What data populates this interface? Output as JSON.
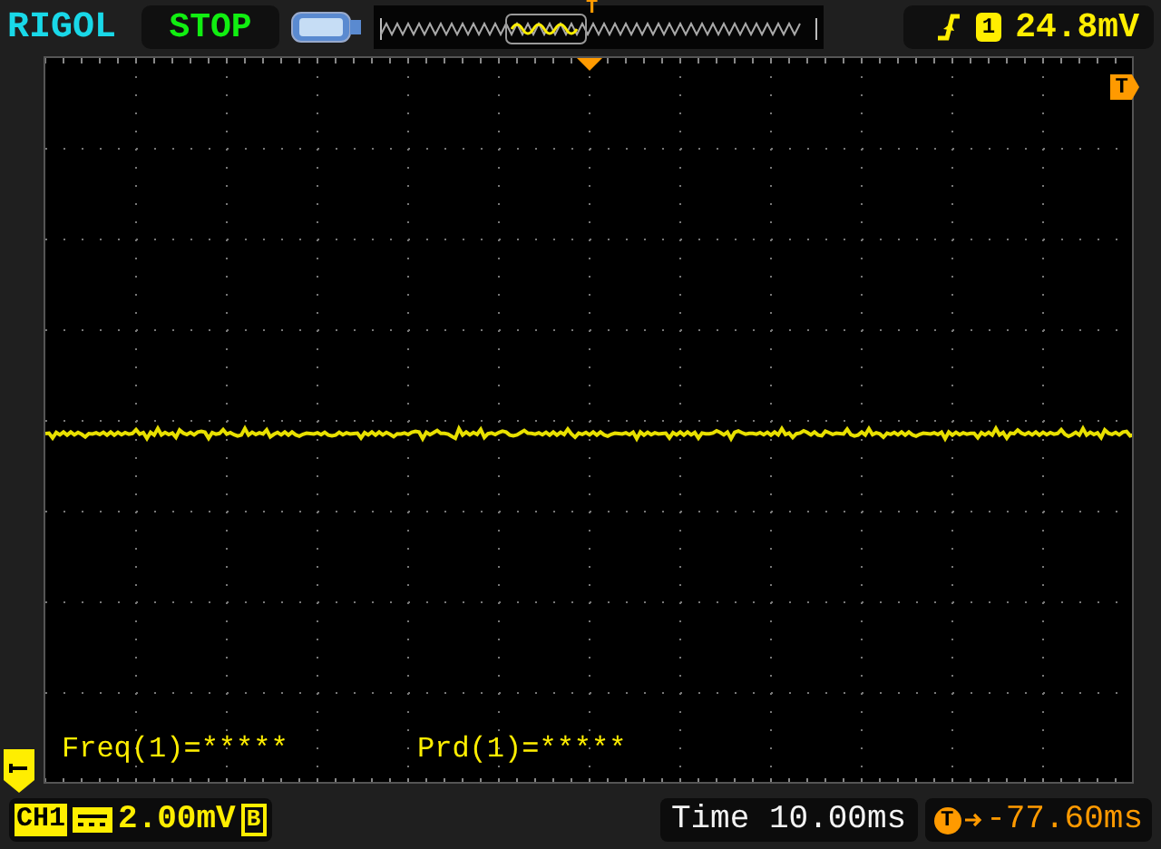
{
  "brand": "RIGOL",
  "run_state": "STOP",
  "memory": {
    "trigger_marker": "T"
  },
  "trigger": {
    "channel": "1",
    "level": "24.8mV"
  },
  "screen": {
    "level_marker": "T"
  },
  "measurements": [
    {
      "text": "Freq(1)=*****"
    },
    {
      "text": "Prd(1)=*****"
    }
  ],
  "channel": {
    "name": "CH1",
    "scale": "2.00mV",
    "bandwidth_limit": "B"
  },
  "timebase": {
    "label": "Time",
    "value": "10.00ms"
  },
  "offset": {
    "marker": "T",
    "value": "-77.60ms"
  }
}
